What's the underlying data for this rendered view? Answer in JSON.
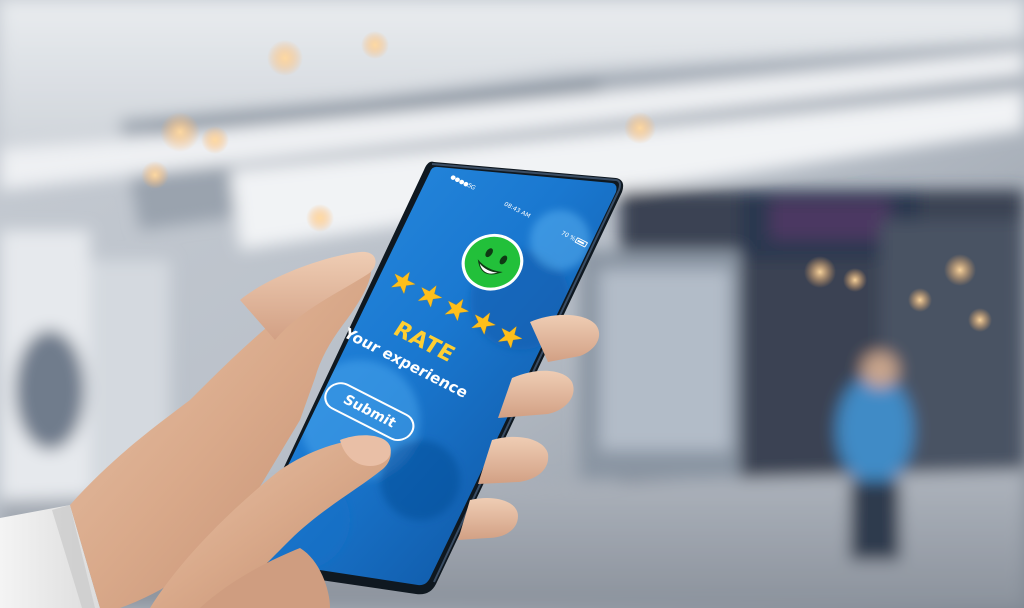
{
  "status_bar": {
    "signal_text": "●●●●5G",
    "time": "08:43 AM",
    "battery_text": "70 %"
  },
  "rating": {
    "face_icon": "smiley-face-icon",
    "face_color": "#22c03a",
    "star_icon": "star-icon",
    "star_color": "#ffbf1a",
    "stars_filled": 5,
    "stars_total": 5,
    "star_glyph": "★",
    "title": "RATE",
    "subtitle": "Your experience",
    "submit_label": "Submit"
  },
  "colors": {
    "screen_blue": "#1b7fd6",
    "screen_dark_blue": "#0d4e98",
    "title_yellow": "#ffcf33"
  }
}
